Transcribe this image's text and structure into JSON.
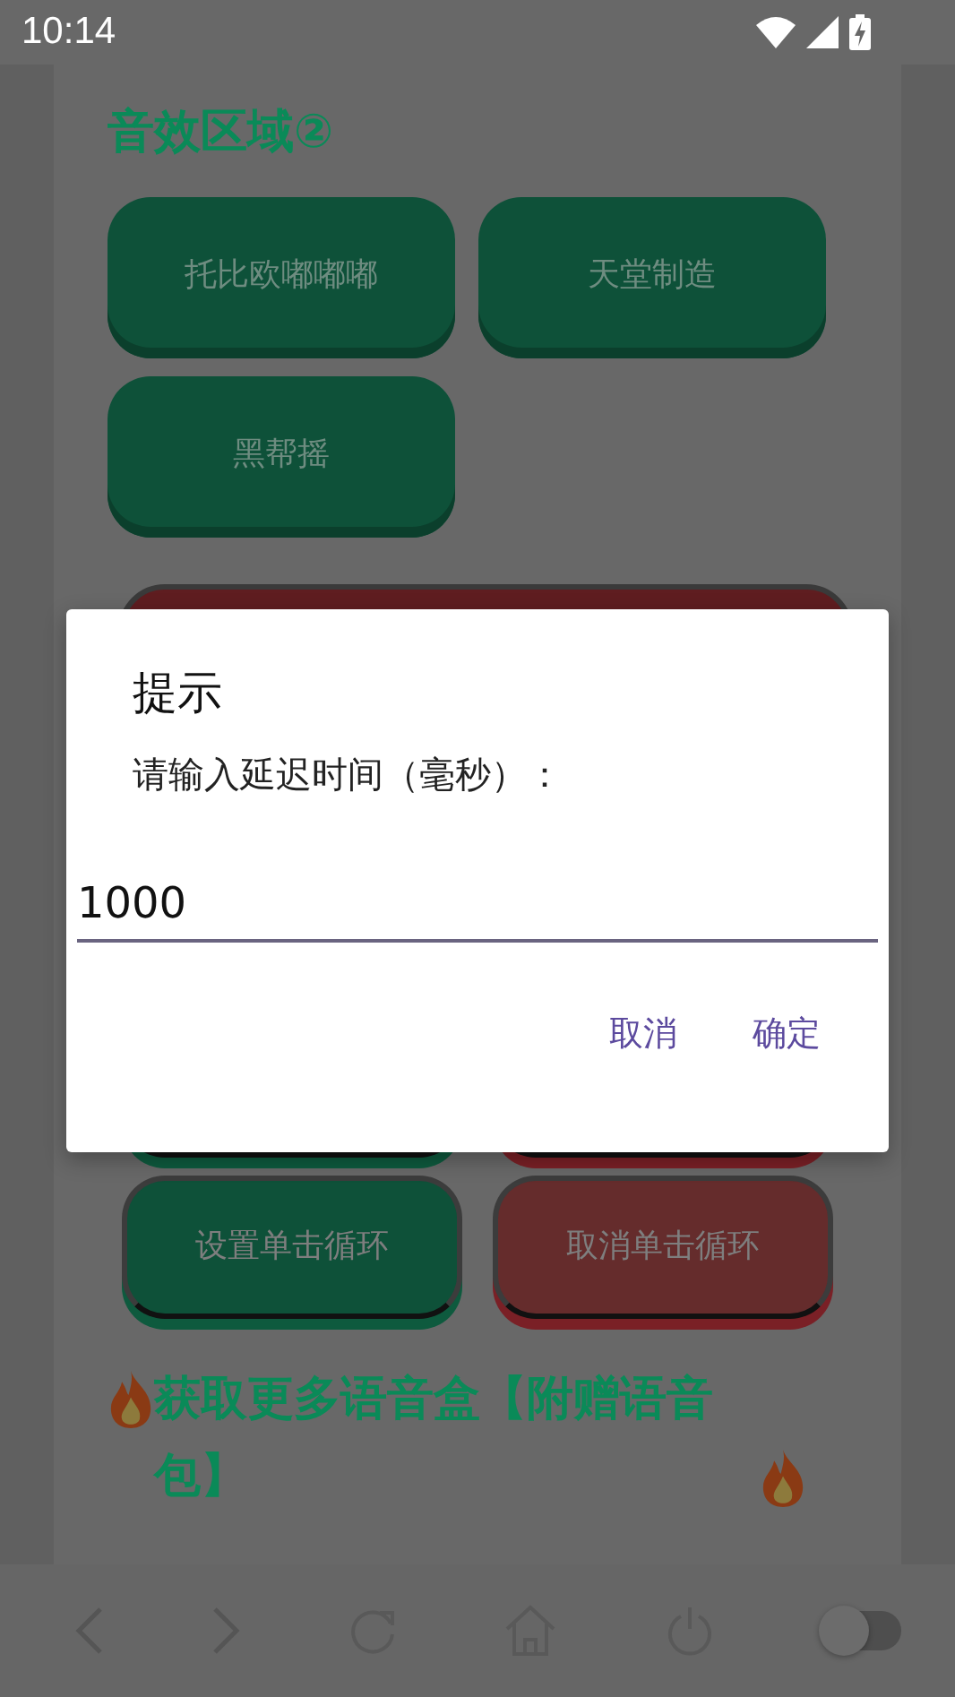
{
  "status_bar": {
    "time": "10:14"
  },
  "section_title": "音效区域②",
  "sound_buttons": [
    {
      "label": "托比欧嘟嘟嘟"
    },
    {
      "label": "天堂制造"
    },
    {
      "label": "黑帮摇"
    }
  ],
  "loop_buttons": [
    {
      "label": "设置单击循环",
      "kind": "set"
    },
    {
      "label": "取消单击循环",
      "kind": "cancel"
    }
  ],
  "promo_heading": "获取更多语音盒【附赠语音包】",
  "dialog": {
    "title": "提示",
    "message": "请输入延迟时间（毫秒）：",
    "value": "1000",
    "buttons": [
      "取消",
      "确定"
    ]
  },
  "nav_toggle": {
    "on": false
  }
}
